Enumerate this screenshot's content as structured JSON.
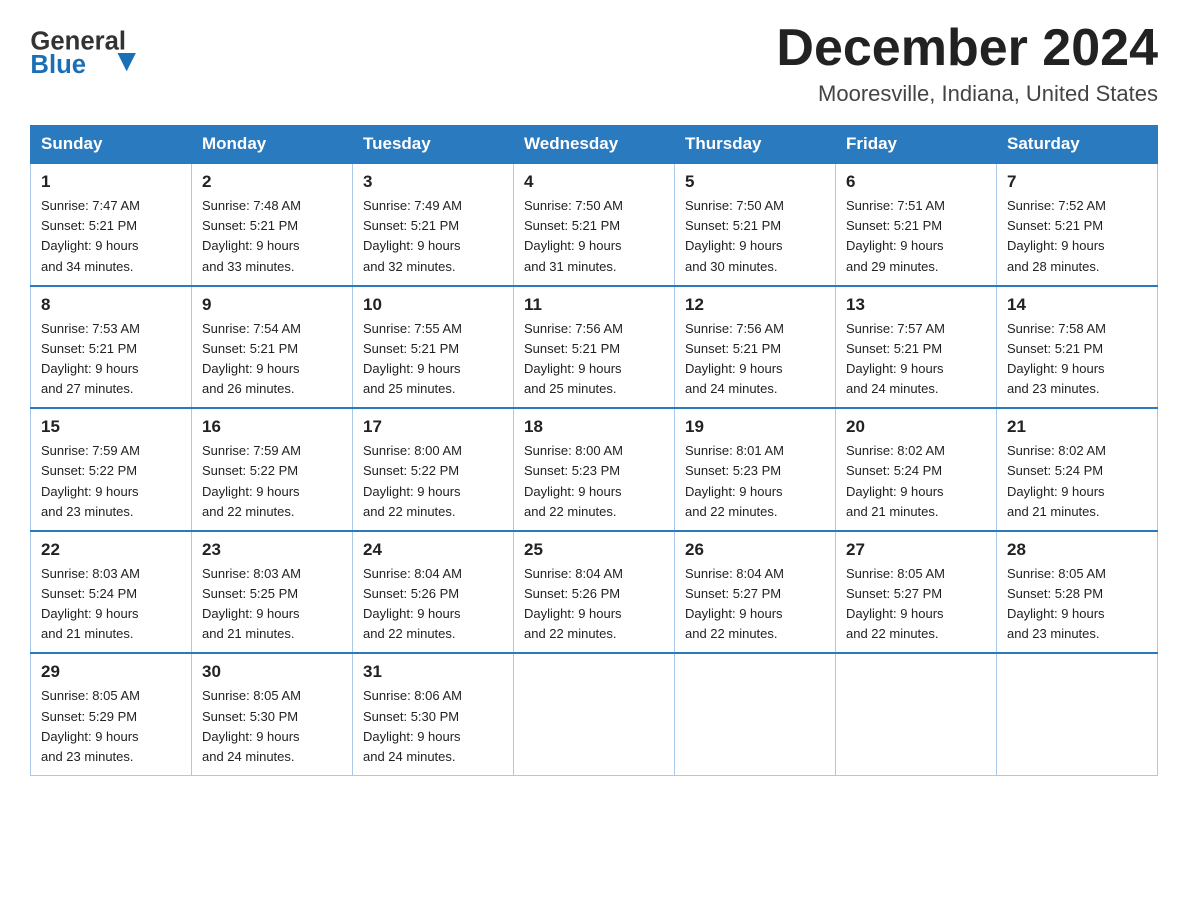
{
  "header": {
    "logo_general": "General",
    "logo_blue": "Blue",
    "month_title": "December 2024",
    "location": "Mooresville, Indiana, United States"
  },
  "weekdays": [
    "Sunday",
    "Monday",
    "Tuesday",
    "Wednesday",
    "Thursday",
    "Friday",
    "Saturday"
  ],
  "weeks": [
    [
      {
        "day": "1",
        "sunrise": "7:47 AM",
        "sunset": "5:21 PM",
        "daylight": "9 hours and 34 minutes."
      },
      {
        "day": "2",
        "sunrise": "7:48 AM",
        "sunset": "5:21 PM",
        "daylight": "9 hours and 33 minutes."
      },
      {
        "day": "3",
        "sunrise": "7:49 AM",
        "sunset": "5:21 PM",
        "daylight": "9 hours and 32 minutes."
      },
      {
        "day": "4",
        "sunrise": "7:50 AM",
        "sunset": "5:21 PM",
        "daylight": "9 hours and 31 minutes."
      },
      {
        "day": "5",
        "sunrise": "7:50 AM",
        "sunset": "5:21 PM",
        "daylight": "9 hours and 30 minutes."
      },
      {
        "day": "6",
        "sunrise": "7:51 AM",
        "sunset": "5:21 PM",
        "daylight": "9 hours and 29 minutes."
      },
      {
        "day": "7",
        "sunrise": "7:52 AM",
        "sunset": "5:21 PM",
        "daylight": "9 hours and 28 minutes."
      }
    ],
    [
      {
        "day": "8",
        "sunrise": "7:53 AM",
        "sunset": "5:21 PM",
        "daylight": "9 hours and 27 minutes."
      },
      {
        "day": "9",
        "sunrise": "7:54 AM",
        "sunset": "5:21 PM",
        "daylight": "9 hours and 26 minutes."
      },
      {
        "day": "10",
        "sunrise": "7:55 AM",
        "sunset": "5:21 PM",
        "daylight": "9 hours and 25 minutes."
      },
      {
        "day": "11",
        "sunrise": "7:56 AM",
        "sunset": "5:21 PM",
        "daylight": "9 hours and 25 minutes."
      },
      {
        "day": "12",
        "sunrise": "7:56 AM",
        "sunset": "5:21 PM",
        "daylight": "9 hours and 24 minutes."
      },
      {
        "day": "13",
        "sunrise": "7:57 AM",
        "sunset": "5:21 PM",
        "daylight": "9 hours and 24 minutes."
      },
      {
        "day": "14",
        "sunrise": "7:58 AM",
        "sunset": "5:21 PM",
        "daylight": "9 hours and 23 minutes."
      }
    ],
    [
      {
        "day": "15",
        "sunrise": "7:59 AM",
        "sunset": "5:22 PM",
        "daylight": "9 hours and 23 minutes."
      },
      {
        "day": "16",
        "sunrise": "7:59 AM",
        "sunset": "5:22 PM",
        "daylight": "9 hours and 22 minutes."
      },
      {
        "day": "17",
        "sunrise": "8:00 AM",
        "sunset": "5:22 PM",
        "daylight": "9 hours and 22 minutes."
      },
      {
        "day": "18",
        "sunrise": "8:00 AM",
        "sunset": "5:23 PM",
        "daylight": "9 hours and 22 minutes."
      },
      {
        "day": "19",
        "sunrise": "8:01 AM",
        "sunset": "5:23 PM",
        "daylight": "9 hours and 22 minutes."
      },
      {
        "day": "20",
        "sunrise": "8:02 AM",
        "sunset": "5:24 PM",
        "daylight": "9 hours and 21 minutes."
      },
      {
        "day": "21",
        "sunrise": "8:02 AM",
        "sunset": "5:24 PM",
        "daylight": "9 hours and 21 minutes."
      }
    ],
    [
      {
        "day": "22",
        "sunrise": "8:03 AM",
        "sunset": "5:24 PM",
        "daylight": "9 hours and 21 minutes."
      },
      {
        "day": "23",
        "sunrise": "8:03 AM",
        "sunset": "5:25 PM",
        "daylight": "9 hours and 21 minutes."
      },
      {
        "day": "24",
        "sunrise": "8:04 AM",
        "sunset": "5:26 PM",
        "daylight": "9 hours and 22 minutes."
      },
      {
        "day": "25",
        "sunrise": "8:04 AM",
        "sunset": "5:26 PM",
        "daylight": "9 hours and 22 minutes."
      },
      {
        "day": "26",
        "sunrise": "8:04 AM",
        "sunset": "5:27 PM",
        "daylight": "9 hours and 22 minutes."
      },
      {
        "day": "27",
        "sunrise": "8:05 AM",
        "sunset": "5:27 PM",
        "daylight": "9 hours and 22 minutes."
      },
      {
        "day": "28",
        "sunrise": "8:05 AM",
        "sunset": "5:28 PM",
        "daylight": "9 hours and 23 minutes."
      }
    ],
    [
      {
        "day": "29",
        "sunrise": "8:05 AM",
        "sunset": "5:29 PM",
        "daylight": "9 hours and 23 minutes."
      },
      {
        "day": "30",
        "sunrise": "8:05 AM",
        "sunset": "5:30 PM",
        "daylight": "9 hours and 24 minutes."
      },
      {
        "day": "31",
        "sunrise": "8:06 AM",
        "sunset": "5:30 PM",
        "daylight": "9 hours and 24 minutes."
      },
      null,
      null,
      null,
      null
    ]
  ],
  "labels": {
    "sunrise": "Sunrise:",
    "sunset": "Sunset:",
    "daylight": "Daylight:"
  }
}
